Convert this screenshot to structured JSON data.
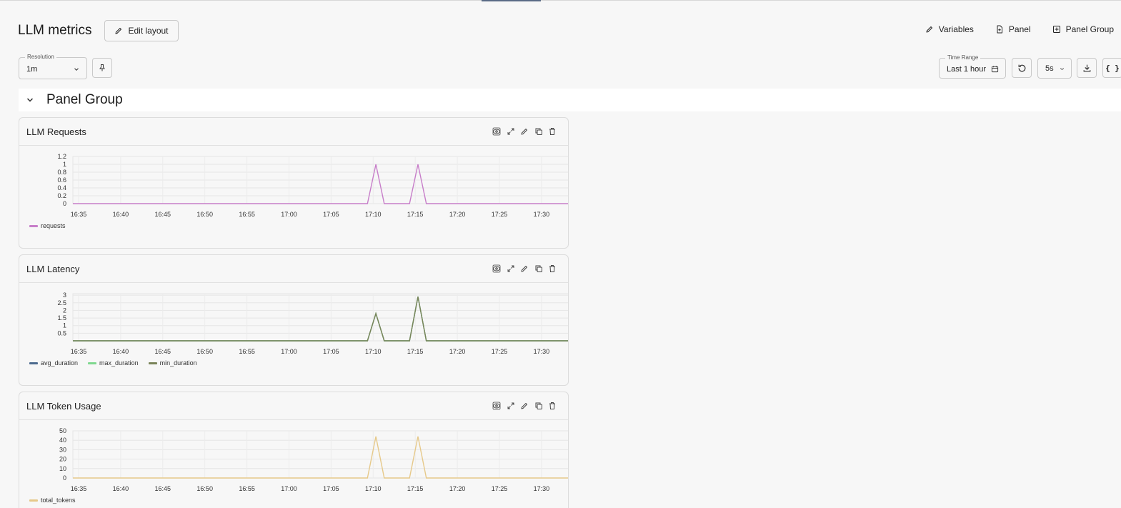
{
  "header": {
    "title": "LLM metrics",
    "edit_layout": "Edit layout",
    "actions": {
      "variables": "Variables",
      "panel": "Panel",
      "panel_group": "Panel Group"
    }
  },
  "toolbar": {
    "resolution_label": "Resolution",
    "resolution_value": "1m",
    "time_range_label": "Time Range",
    "time_range_value": "Last 1 hour",
    "refresh_interval": "5s",
    "json_icon_text": "{ }"
  },
  "panel_group": {
    "title": "Panel Group"
  },
  "colors": {
    "requests": "#c77ec9",
    "avg_duration": "#4c6a8f",
    "max_duration": "#7fd88f",
    "min_duration": "#7a8459",
    "total_tokens": "#e6c98a"
  },
  "panels": [
    {
      "title": "LLM Requests",
      "legend": [
        "requests"
      ]
    },
    {
      "title": "LLM Latency",
      "legend": [
        "avg_duration",
        "max_duration",
        "min_duration"
      ]
    },
    {
      "title": "LLM Token Usage",
      "legend": [
        "total_tokens"
      ]
    }
  ],
  "chart_data": [
    {
      "type": "line",
      "title": "LLM Requests",
      "x_ticks": [
        "16:35",
        "16:40",
        "16:45",
        "16:50",
        "16:55",
        "17:00",
        "17:05",
        "17:10",
        "17:15",
        "17:20",
        "17:25",
        "17:30"
      ],
      "y_ticks": [
        "0",
        "0.2",
        "0.4",
        "0.6",
        "0.8",
        "1",
        "1.2"
      ],
      "ylim": [
        0,
        1.2
      ],
      "series": [
        {
          "name": "requests",
          "points": [
            [
              "16:35",
              0
            ],
            [
              "17:10",
              0
            ],
            [
              "17:11",
              1
            ],
            [
              "17:12",
              0
            ],
            [
              "17:15",
              0
            ],
            [
              "17:16",
              1
            ],
            [
              "17:17",
              0
            ],
            [
              "17:34",
              0
            ]
          ]
        }
      ]
    },
    {
      "type": "line",
      "title": "LLM Latency",
      "x_ticks": [
        "16:35",
        "16:40",
        "16:45",
        "16:50",
        "16:55",
        "17:00",
        "17:05",
        "17:10",
        "17:15",
        "17:20",
        "17:25",
        "17:30"
      ],
      "y_ticks": [
        "0.5",
        "1",
        "1.5",
        "2",
        "2.5",
        "3"
      ],
      "ylim": [
        0,
        3.1
      ],
      "series": [
        {
          "name": "avg_duration",
          "points": [
            [
              "16:35",
              0
            ],
            [
              "17:10",
              0
            ],
            [
              "17:11",
              1.8
            ],
            [
              "17:12",
              0
            ],
            [
              "17:15",
              0
            ],
            [
              "17:16",
              2.9
            ],
            [
              "17:17",
              0
            ],
            [
              "17:34",
              0
            ]
          ]
        },
        {
          "name": "max_duration",
          "points": [
            [
              "16:35",
              0
            ],
            [
              "17:10",
              0
            ],
            [
              "17:11",
              1.8
            ],
            [
              "17:12",
              0
            ],
            [
              "17:15",
              0
            ],
            [
              "17:16",
              2.9
            ],
            [
              "17:17",
              0
            ],
            [
              "17:34",
              0
            ]
          ]
        },
        {
          "name": "min_duration",
          "points": [
            [
              "16:35",
              0
            ],
            [
              "17:10",
              0
            ],
            [
              "17:11",
              1.8
            ],
            [
              "17:12",
              0
            ],
            [
              "17:15",
              0
            ],
            [
              "17:16",
              2.9
            ],
            [
              "17:17",
              0
            ],
            [
              "17:34",
              0
            ]
          ]
        }
      ]
    },
    {
      "type": "line",
      "title": "LLM Token Usage",
      "x_ticks": [
        "16:35",
        "16:40",
        "16:45",
        "16:50",
        "16:55",
        "17:00",
        "17:05",
        "17:10",
        "17:15",
        "17:20",
        "17:25",
        "17:30"
      ],
      "y_ticks": [
        "0",
        "10",
        "20",
        "30",
        "40",
        "50"
      ],
      "ylim": [
        0,
        50
      ],
      "series": [
        {
          "name": "total_tokens",
          "points": [
            [
              "16:35",
              0
            ],
            [
              "17:10",
              0
            ],
            [
              "17:11",
              44
            ],
            [
              "17:12",
              0
            ],
            [
              "17:15",
              0
            ],
            [
              "17:16",
              44
            ],
            [
              "17:17",
              0
            ],
            [
              "17:34",
              0
            ]
          ]
        }
      ]
    }
  ]
}
